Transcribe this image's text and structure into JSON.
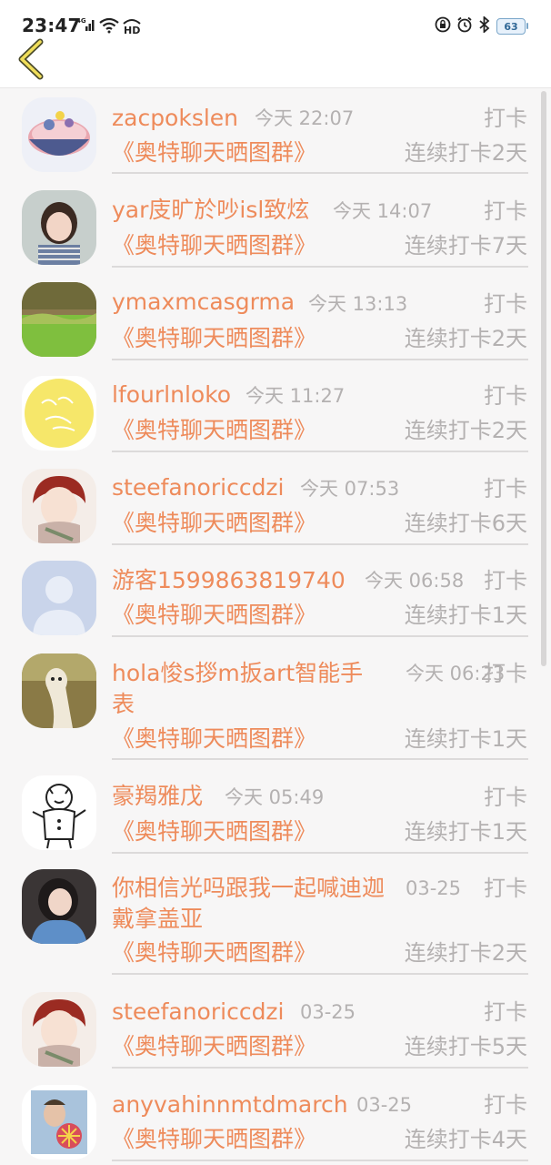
{
  "status_bar": {
    "time": "23:47",
    "network": "4G",
    "battery": "63"
  },
  "entries": [
    {
      "name": "zacpokslen",
      "time": "今天 22:07",
      "checkin": "打卡",
      "group": "《奥特聊天晒图群》",
      "streak": "连续打卡2天",
      "avatar": "bowl-avatar"
    },
    {
      "name": "yar庋旷於吵isl致炫",
      "time": "今天 14:07",
      "checkin": "打卡",
      "group": "《奥特聊天晒图群》",
      "streak": "连续打卡7天",
      "avatar": "girl-avatar"
    },
    {
      "name": "ymaxmcasgrma",
      "time": "今天 13:13",
      "checkin": "打卡",
      "group": "《奥特聊天晒图群》",
      "streak": "连续打卡2天",
      "avatar": "grass-avatar"
    },
    {
      "name": "lfourlnloko",
      "time": "今天 11:27",
      "checkin": "打卡",
      "group": "《奥特聊天晒图群》",
      "streak": "连续打卡2天",
      "avatar": "yellow-avatar"
    },
    {
      "name": "steefanoriccdzi",
      "time": "今天 07:53",
      "checkin": "打卡",
      "group": "《奥特聊天晒图群》",
      "streak": "连续打卡6天",
      "avatar": "anime-avatar"
    },
    {
      "name": "游客1599863819740",
      "time": "今天 06:58",
      "checkin": "打卡",
      "group": "《奥特聊天晒图群》",
      "streak": "连续打卡1天",
      "avatar": "default-avatar"
    },
    {
      "name": "hola悛s拶m扳art智能手表",
      "time": "今天 06:23",
      "checkin": "打卡",
      "group": "《奥特聊天晒图群》",
      "streak": "连续打卡1天",
      "avatar": "alpaca-avatar"
    },
    {
      "name": "豪羯雅戊",
      "time": "今天 05:49",
      "checkin": "打卡",
      "group": "《奥特聊天晒图群》",
      "streak": "连续打卡1天",
      "avatar": "tiger-avatar"
    },
    {
      "name": "你相信光吗跟我一起喊迪迦戴拿盖亚",
      "time": "03-25",
      "checkin": "打卡",
      "group": "《奥特聊天晒图群》",
      "streak": "连续打卡2天",
      "avatar": "woman-avatar"
    },
    {
      "name": "steefanoriccdzi",
      "time": "03-25",
      "checkin": "打卡",
      "group": "《奥特聊天晒图群》",
      "streak": "连续打卡5天",
      "avatar": "anime-avatar"
    },
    {
      "name": "anyvahinnmtdmarch",
      "time": "03-25",
      "checkin": "打卡",
      "group": "《奥特聊天晒图群》",
      "streak": "连续打卡4天",
      "avatar": "man-avatar"
    }
  ]
}
